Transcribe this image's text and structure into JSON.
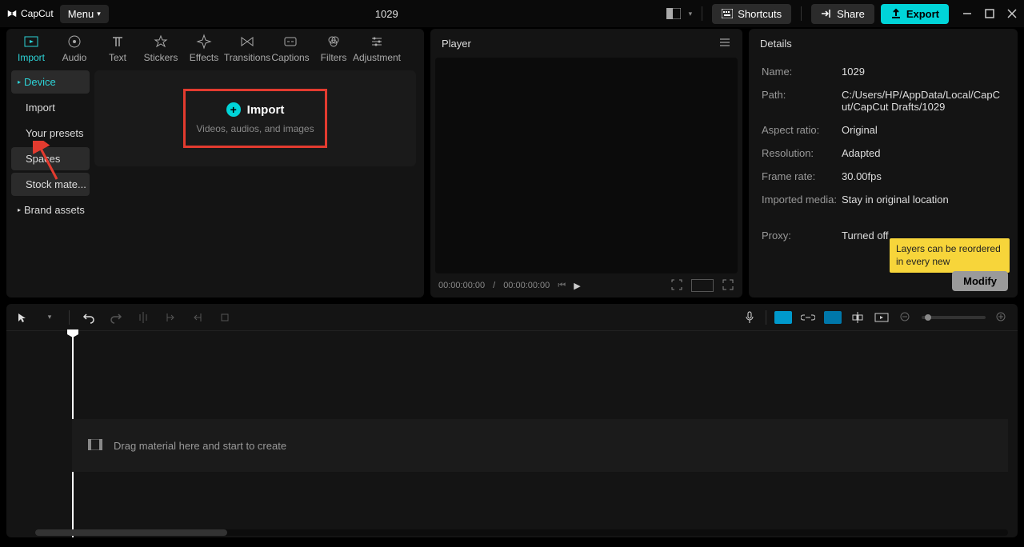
{
  "app": {
    "brand": "CapCut",
    "menu_label": "Menu",
    "project_title": "1029",
    "shortcuts": "Shortcuts",
    "share": "Share",
    "export": "Export"
  },
  "tabs": {
    "import": "Import",
    "audio": "Audio",
    "text": "Text",
    "stickers": "Stickers",
    "effects": "Effects",
    "transitions": "Transitions",
    "captions": "Captions",
    "filters": "Filters",
    "adjustment": "Adjustment"
  },
  "sidebar": {
    "device": "Device",
    "import": "Import",
    "your_presets": "Your presets",
    "spaces": "Spaces",
    "stock_materials": "Stock mate...",
    "brand_assets": "Brand assets"
  },
  "import_card": {
    "title": "Import",
    "subtitle": "Videos, audios, and images"
  },
  "player": {
    "title": "Player",
    "time_current": "00:00:00:00",
    "time_total": "00:00:00:00"
  },
  "details": {
    "title": "Details",
    "name_label": "Name:",
    "name_value": "1029",
    "path_label": "Path:",
    "path_value": "C:/Users/HP/AppData/Local/CapCut/CapCut Drafts/1029",
    "aspect_label": "Aspect ratio:",
    "aspect_value": "Original",
    "resolution_label": "Resolution:",
    "resolution_value": "Adapted",
    "framerate_label": "Frame rate:",
    "framerate_value": "30.00fps",
    "imported_label": "Imported media:",
    "imported_value": "Stay in original location",
    "proxy_label": "Proxy:",
    "proxy_value": "Turned off",
    "tooltip": "Layers can be reordered in every new",
    "modify": "Modify"
  },
  "timeline": {
    "drop_text": "Drag material here and start to create"
  }
}
